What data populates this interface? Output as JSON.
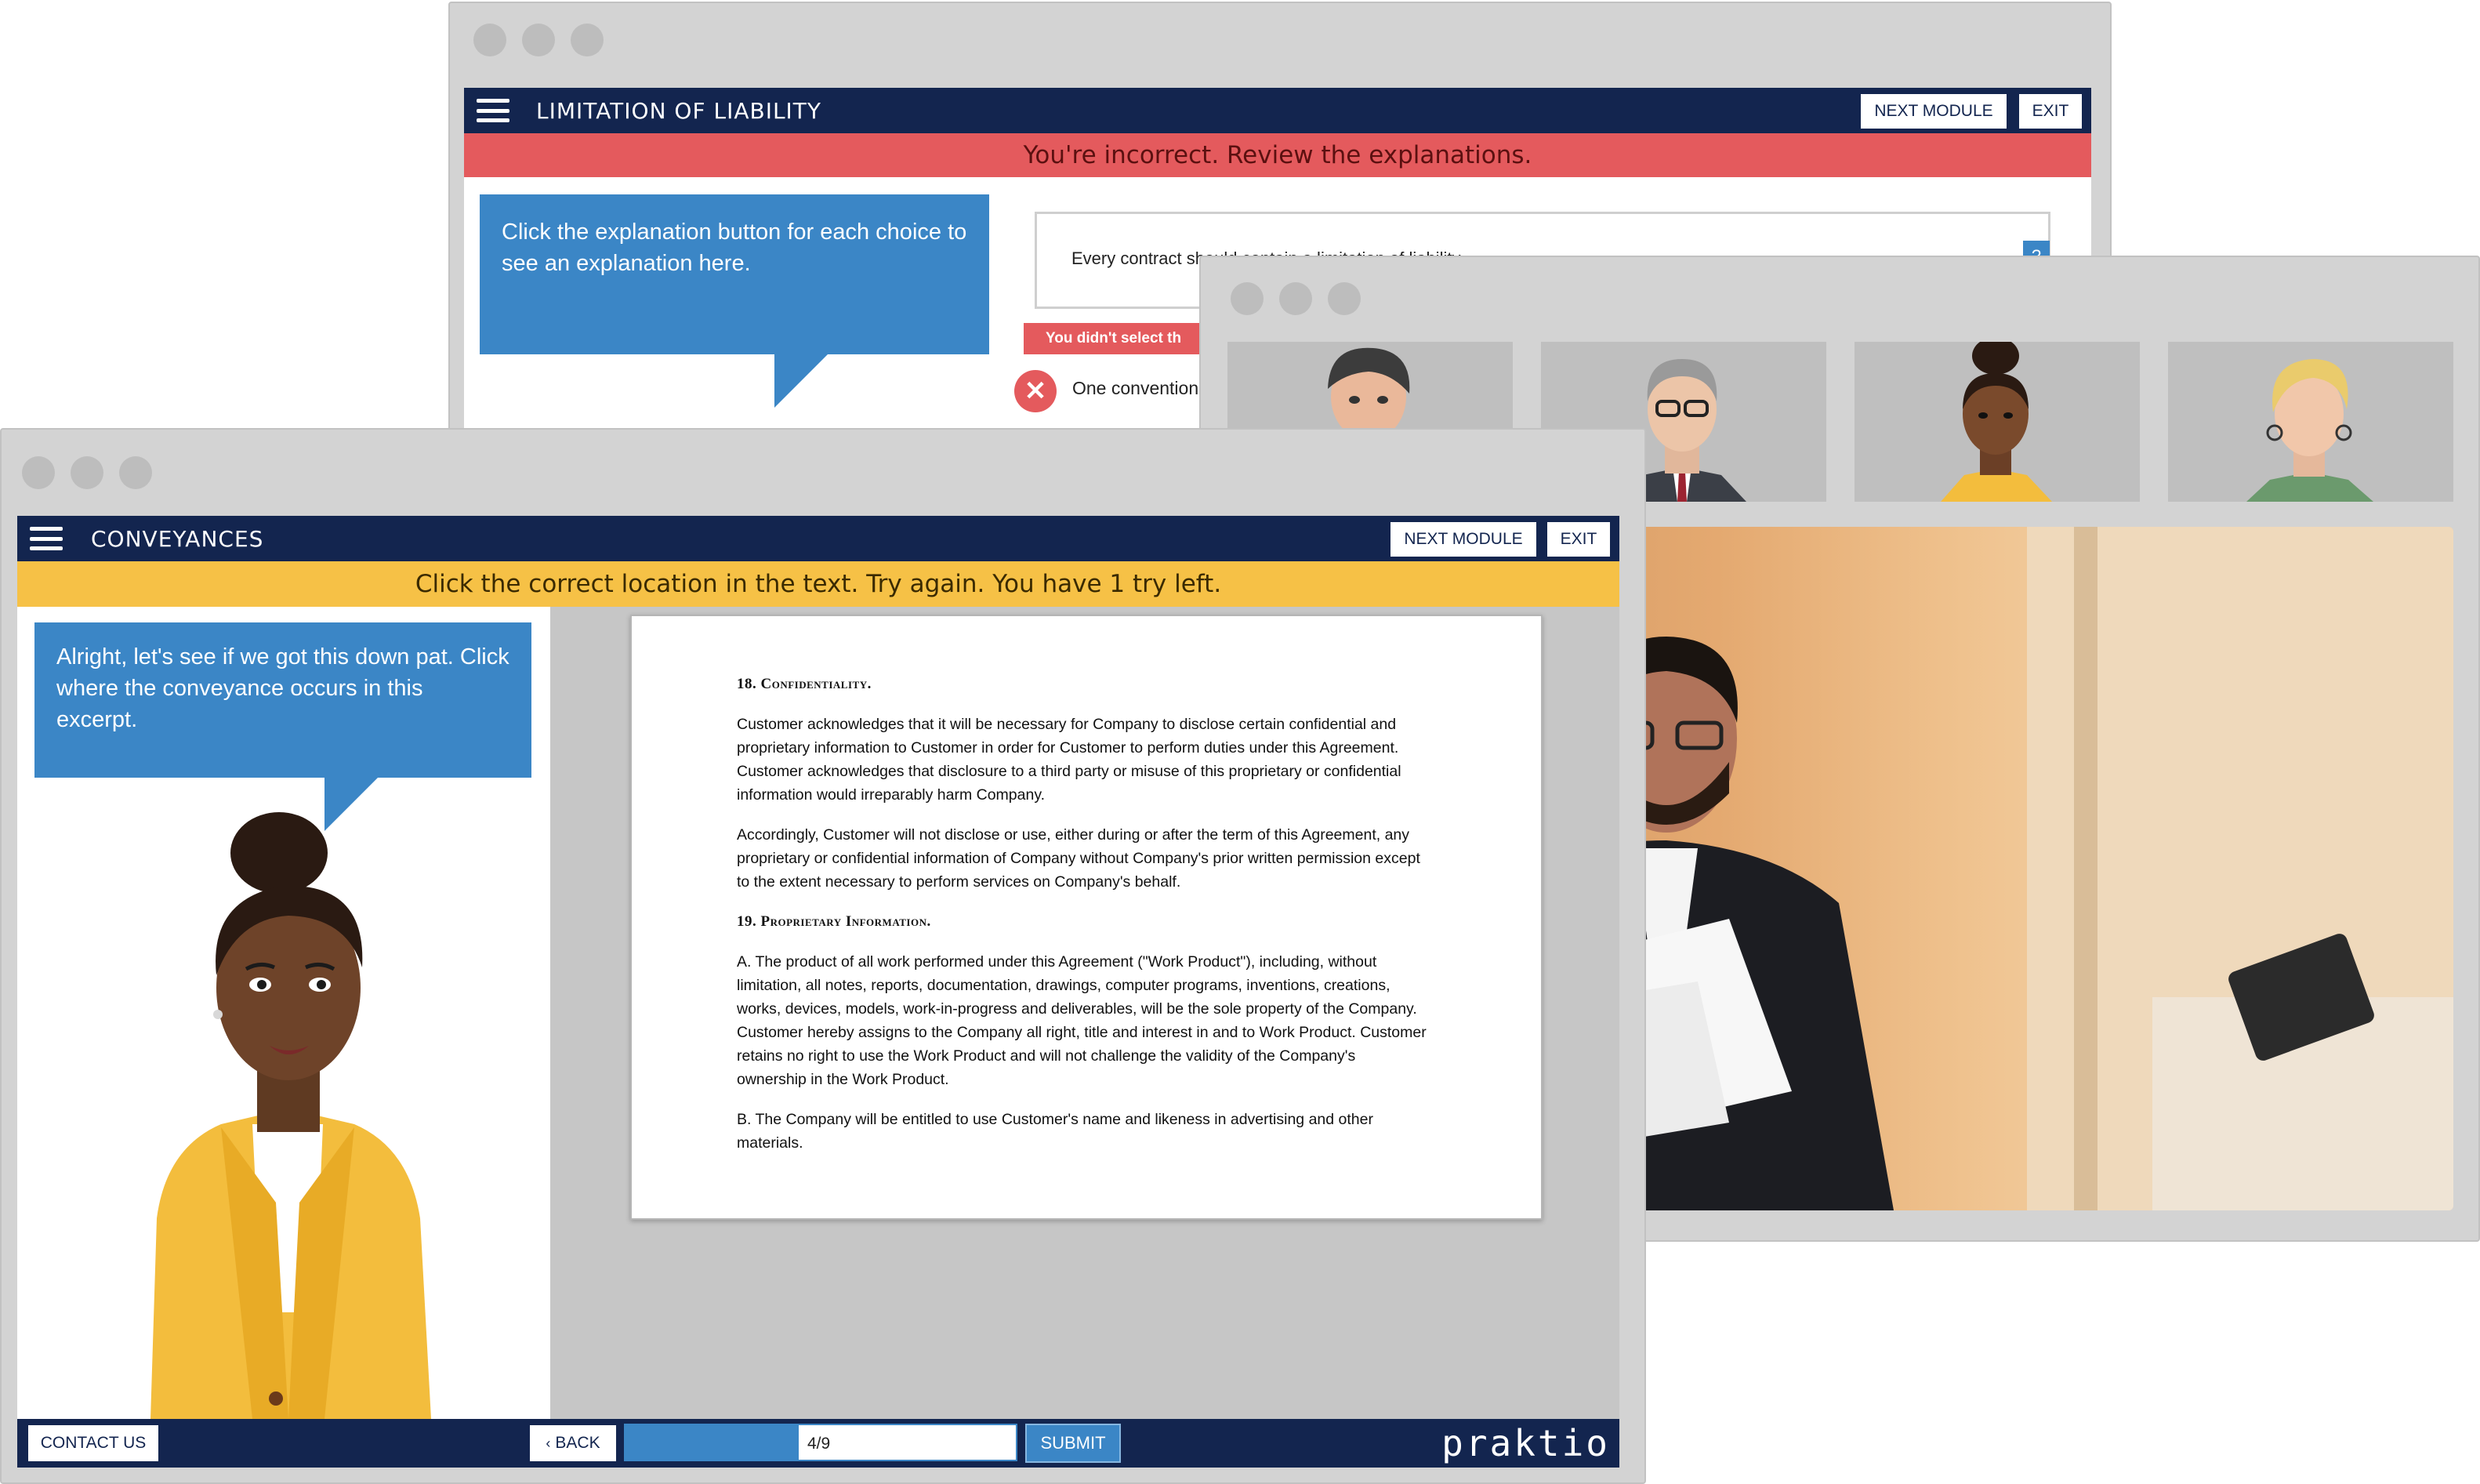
{
  "back_window": {
    "title": "LIMITATION OF LIABILITY",
    "next_module": "NEXT MODULE",
    "exit": "EXIT",
    "alert": "You're incorrect. Review the explanations.",
    "bubble": "Click the explanation button for each choice to see an explanation here.",
    "question_text": "Every contract should contain a limitation of liability",
    "question_btn": "?",
    "missed_label": "You didn't select th",
    "choice_text": "One convention",
    "colors": {
      "navbar": "#13254f",
      "alert": "#e45a5d",
      "bubble": "#3b86c6"
    }
  },
  "video_window": {
    "participants": [
      "participant-1",
      "participant-2",
      "participant-3",
      "participant-4"
    ]
  },
  "front_window": {
    "title": "CONVEYANCES",
    "next_module": "NEXT MODULE",
    "exit": "EXIT",
    "alert": "Click the correct location in the text. Try again. You have 1 try left.",
    "bubble": "Alright, let's see if we got this down pat. Click where the conveyance occurs in this excerpt.",
    "document": {
      "s18_heading_num": "18.",
      "s18_heading": "Confidentiality.",
      "p1": "Customer acknowledges that it will be necessary for Company to disclose certain confidential and proprietary information to Customer in order for Customer to perform duties under this Agreement. Customer acknowledges that disclosure to a third party or misuse of this proprietary or confidential information would irreparably harm Company.",
      "p2": "Accordingly, Customer will not disclose or use, either during or after the term of this Agreement, any proprietary or confidential information of Company without Company's prior written permission except to the extent necessary to perform services on Company's behalf.",
      "s19_heading_num": "19.",
      "s19_heading": "Proprietary Information.",
      "p3": "A. The product of all work performed under this Agreement (\"Work Product\"), including, without limitation, all notes, reports, documentation, drawings, computer programs, inventions, creations, works, devices, models, work-in-progress and deliverables, will be the sole property of the Company. Customer hereby assigns to the Company all right, title and interest in and to Work Product. Customer retains no right to use the Work Product and will not challenge the validity of the Company's ownership in the Work Product.",
      "p4": "B. The Company will be entitled to use Customer's name and likeness in advertising and other materials."
    },
    "footer": {
      "contact": "CONTACT US",
      "back": "BACK",
      "progress_text": "4/9",
      "progress_fraction": 0.444,
      "submit": "SUBMIT",
      "logo": "praktio"
    },
    "colors": {
      "navbar": "#13254f",
      "alert": "#f6c146",
      "bubble": "#3b86c6",
      "progress": "#3b86c6"
    }
  }
}
